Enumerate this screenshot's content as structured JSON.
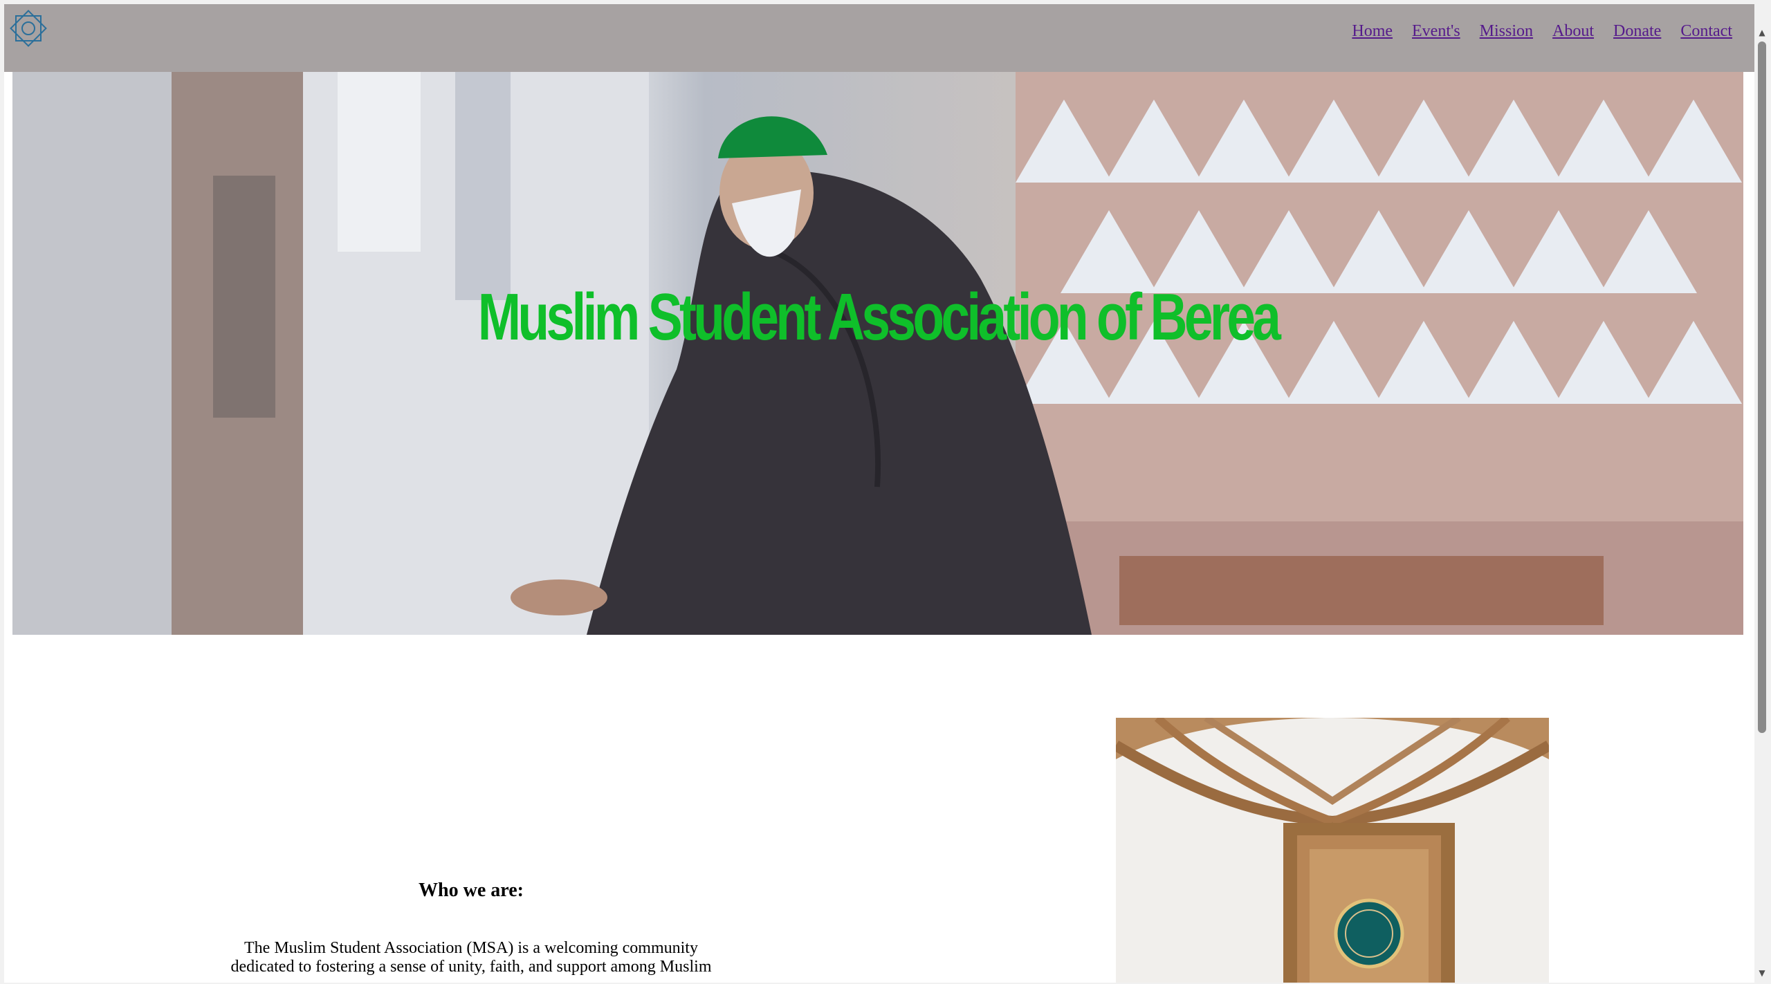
{
  "nav": {
    "logo_icon": "eight-point-star-logo-icon",
    "links": [
      "Home",
      "Event's",
      "Mission",
      "About",
      "Donate",
      "Contact"
    ]
  },
  "hero": {
    "title": "Muslim Student Association of Berea",
    "image": "man-praying-in-mosque-photo"
  },
  "about": {
    "heading": "Who we are:",
    "body_line1": "The Muslim Student Association (MSA) is a welcoming community",
    "body_line2": "dedicated to fostering a sense of unity, faith, and support among Muslim",
    "image": "mosque-mihrab-interior-photo"
  },
  "colors": {
    "navbar": "#a7a2a2",
    "link": "#551a8b",
    "title": "#0fbf2a"
  }
}
